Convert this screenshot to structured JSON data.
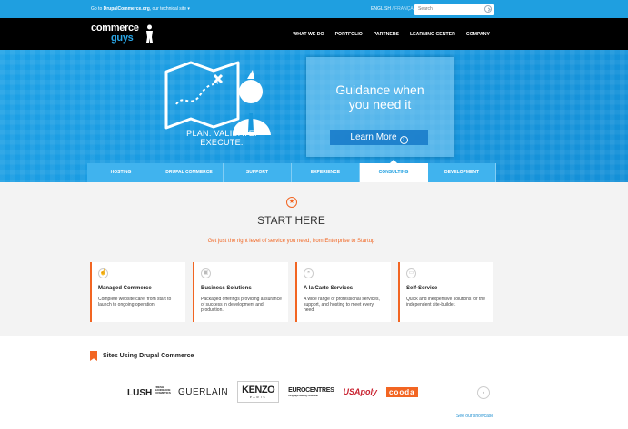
{
  "topbar": {
    "goto_prefix": "Go to",
    "goto_link": "DrupalCommerce.org",
    "goto_suffix": ", our technical site ▾",
    "lang_active": "ENGLISH",
    "lang_sep": " / ",
    "lang_other": "FRANÇAIS",
    "search_placeholder": "Search",
    "search_icon": "arrow-right-circle-icon"
  },
  "header": {
    "logo_line1": "commerce",
    "logo_line2": "guys",
    "nav": [
      "WHAT WE DO",
      "PORTFOLIO",
      "PARTNERS",
      "LEARNING CENTER",
      "COMPANY"
    ]
  },
  "hero": {
    "tagline": "PLAN. VALIDATE. EXECUTE.",
    "card_title_1": "Guidance when",
    "card_title_2": "you need it",
    "cta": "Learn More"
  },
  "tabs": [
    "HOSTING",
    "DRUPAL COMMERCE",
    "SUPPORT",
    "EXPERIENCE",
    "CONSULTING",
    "DEVELOPMENT"
  ],
  "active_tab": 4,
  "main": {
    "title": "START HERE",
    "subtitle": "Get just the right level of service you need, from Enterprise to Startup",
    "cards": [
      {
        "title": "Managed Commerce",
        "text": "Complete website care, from start to launch to ongoing operation."
      },
      {
        "title": "Business Solutions",
        "text": "Packaged offerings providing assurance of success in development and production."
      },
      {
        "title": "A la Carte Services",
        "text": "A wide range of professional services, support, and hosting to meet every need."
      },
      {
        "title": "Self-Service",
        "text": "Quick and inexpensive solutions for the independent site-builder."
      }
    ]
  },
  "sites": {
    "heading": "Sites Using Drupal Commerce",
    "logos": [
      "LUSH",
      "GUERLAIN",
      "KENZO",
      "EUROCENTRES",
      "USApoly",
      "cooda"
    ],
    "lush_small": "FRESH HANDMADE COSMETICS",
    "kenzo_small": "PARIS",
    "euro_small": "Language Learning Worldwide",
    "showcase": "See our showcase"
  },
  "colors": {
    "topbar": "#1f9fe0",
    "accent": "#f26522",
    "hero": "#1797dc"
  }
}
